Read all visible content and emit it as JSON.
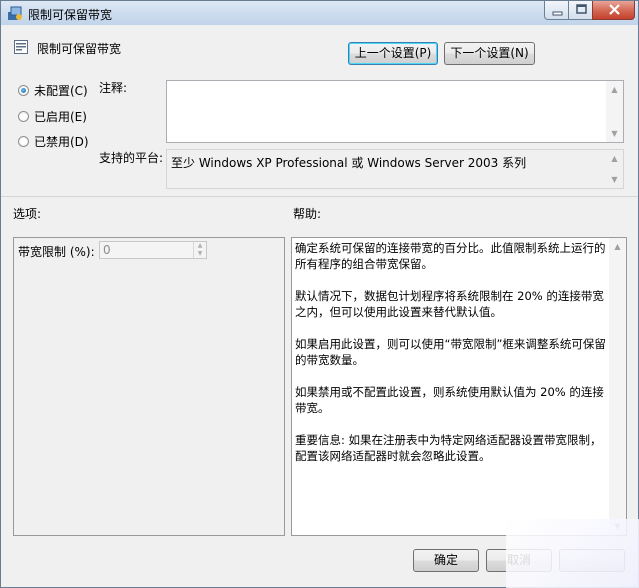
{
  "window": {
    "title": "限制可保留带宽"
  },
  "header": {
    "policy_name": "限制可保留带宽",
    "prev_label": "上一个设置(P)",
    "next_label": "下一个设置(N)"
  },
  "state": {
    "options": [
      {
        "label": "未配置(C)",
        "checked": true
      },
      {
        "label": "已启用(E)",
        "checked": false
      },
      {
        "label": "已禁用(D)",
        "checked": false
      }
    ]
  },
  "comment": {
    "label": "注释:",
    "value": ""
  },
  "platform": {
    "label": "支持的平台:",
    "value": "至少 Windows XP Professional 或 Windows Server 2003 系列"
  },
  "sections": {
    "options_label": "选项:",
    "help_label": "帮助:"
  },
  "options_panel": {
    "bandwidth_label": "带宽限制 (%):",
    "bandwidth_value": "0"
  },
  "help": {
    "paragraphs": [
      "确定系统可保留的连接带宽的百分比。此值限制系统上运行的所有程序的组合带宽保留。",
      "默认情况下，数据包计划程序将系统限制在 20% 的连接带宽之内，但可以使用此设置来替代默认值。",
      "如果启用此设置，则可以使用“带宽限制”框来调整系统可保留的带宽数量。",
      "如果禁用或不配置此设置，则系统使用默认值为 20% 的连接带宽。",
      "重要信息: 如果在注册表中为特定网络适配器设置带宽限制，配置该网络适配器时就会忽略此设置。"
    ]
  },
  "footer": {
    "ok_label": "确定",
    "cancel_label": "取消"
  }
}
